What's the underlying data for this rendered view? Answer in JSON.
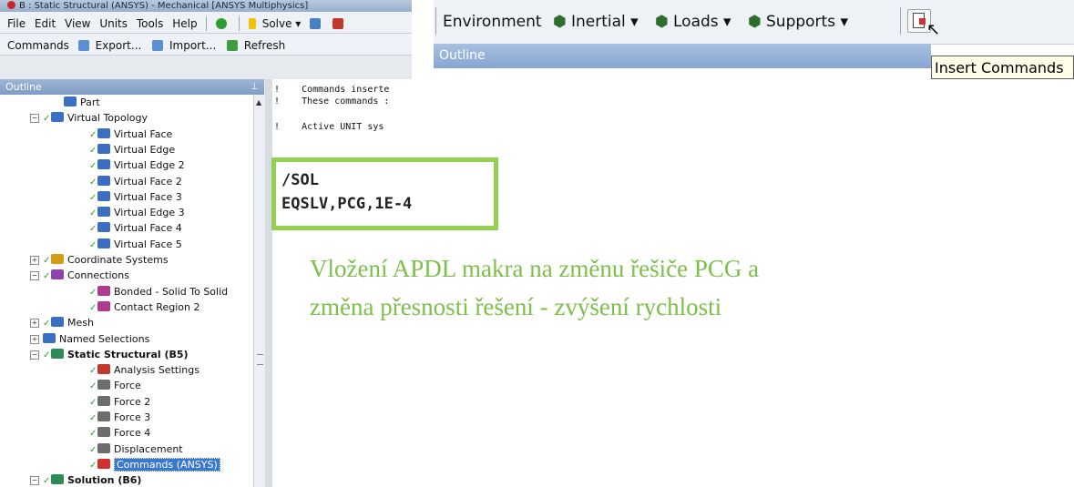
{
  "window": {
    "title": "B : Static Structural (ANSYS) - Mechanical [ANSYS Multiphysics]"
  },
  "menu": [
    "File",
    "Edit",
    "View",
    "Units",
    "Tools",
    "Help"
  ],
  "toolbar": {
    "solve_label": "Solve ▾"
  },
  "command_bar": {
    "commands": "Commands",
    "export": "Export...",
    "import": "Import...",
    "refresh": "Refresh"
  },
  "outline": {
    "header": "Outline",
    "items": [
      {
        "label": "Part",
        "icon": "part-icon"
      },
      {
        "label": "Virtual Topology",
        "icon": "virtual-topology-icon"
      },
      {
        "label": "Virtual Face",
        "icon": "virtual-face-icon"
      },
      {
        "label": "Virtual Edge",
        "icon": "virtual-edge-icon"
      },
      {
        "label": "Virtual Edge 2",
        "icon": "virtual-edge-icon"
      },
      {
        "label": "Virtual Face 2",
        "icon": "virtual-face-icon"
      },
      {
        "label": "Virtual Face 3",
        "icon": "virtual-face-icon"
      },
      {
        "label": "Virtual Edge 3",
        "icon": "virtual-edge-icon"
      },
      {
        "label": "Virtual Face 4",
        "icon": "virtual-face-icon"
      },
      {
        "label": "Virtual Face 5",
        "icon": "virtual-face-icon"
      },
      {
        "label": "Coordinate Systems",
        "icon": "coordinate-systems-icon"
      },
      {
        "label": "Connections",
        "icon": "connections-icon"
      },
      {
        "label": "Bonded - Solid To Solid",
        "icon": "bonded-contact-icon"
      },
      {
        "label": "Contact Region 2",
        "icon": "contact-region-icon"
      },
      {
        "label": "Mesh",
        "icon": "mesh-icon"
      },
      {
        "label": "Named Selections",
        "icon": "named-selections-icon"
      },
      {
        "label": "Static Structural (B5)",
        "icon": "static-structural-icon"
      },
      {
        "label": "Analysis Settings",
        "icon": "analysis-settings-icon"
      },
      {
        "label": "Force",
        "icon": "force-icon"
      },
      {
        "label": "Force 2",
        "icon": "force-icon"
      },
      {
        "label": "Force 3",
        "icon": "force-icon"
      },
      {
        "label": "Force 4",
        "icon": "force-icon"
      },
      {
        "label": "Displacement",
        "icon": "displacement-icon"
      },
      {
        "label": "Commands (ANSYS)",
        "icon": "commands-icon"
      },
      {
        "label": "Solution (B6)",
        "icon": "solution-icon"
      }
    ]
  },
  "editor": {
    "lines": [
      "!    Commands inserte",
      "!    These commands :",
      "!    Active UNIT sys"
    ]
  },
  "highlight": {
    "line1": "/SOL",
    "line2": "EQSLV,PCG,1E-4",
    "border_color": "#92d050"
  },
  "caption": {
    "line1": "Vložení APDL makra na změnu řešiče PCG a",
    "line2": "změna přesnosti řešení - zvýšení rychlosti",
    "color": "#7cbf4a"
  },
  "right_toolbar": {
    "environment": "Environment",
    "inertial": "Inertial ▾",
    "loads": "Loads ▾",
    "supports": "Supports ▾",
    "outline_header": "Outline",
    "tooltip": "Insert Commands"
  }
}
